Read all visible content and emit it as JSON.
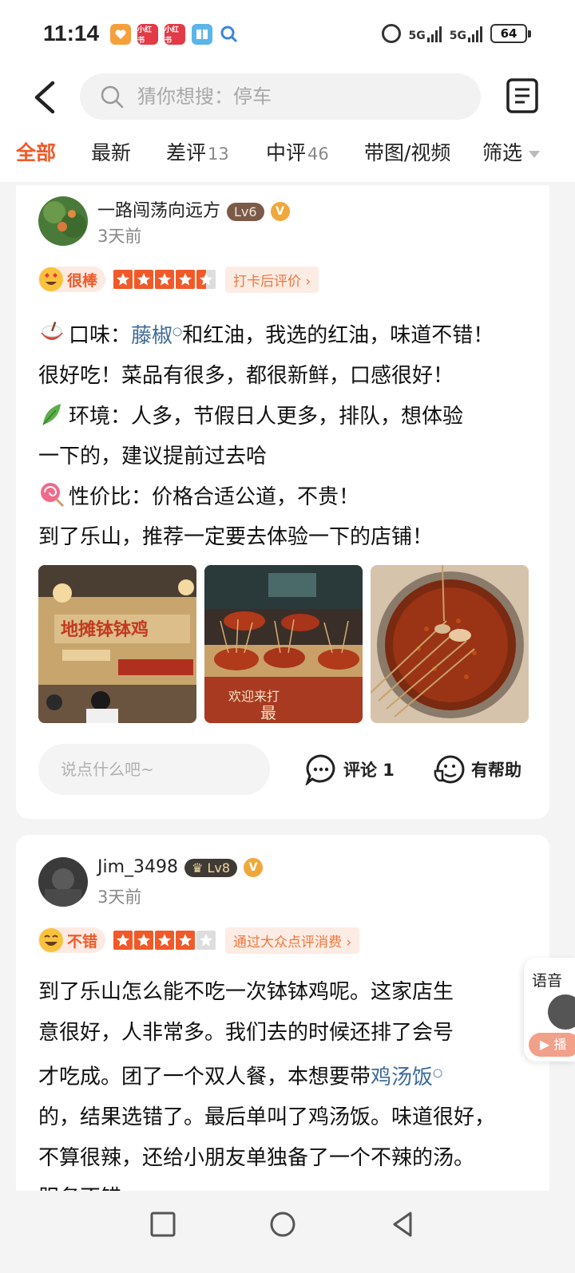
{
  "status_bar": {
    "time": "11:14",
    "app_icons": [
      {
        "name": "heart-app-icon",
        "color": "#f5a03b",
        "label": ""
      },
      {
        "name": "xiaohongshu-icon",
        "color": "#e23a46",
        "label": "小红书"
      },
      {
        "name": "xiaohongshu-icon",
        "color": "#e23a46",
        "label": "小红书"
      },
      {
        "name": "book-app-icon",
        "color": "#5bb5e8",
        "label": ""
      }
    ],
    "signal_1": "5G",
    "signal_2": "5G",
    "battery": "64"
  },
  "header": {
    "search_placeholder": "猜你想搜：停车"
  },
  "tabs": {
    "items": [
      {
        "label": "全部",
        "count": "",
        "active": true
      },
      {
        "label": "最新",
        "count": ""
      },
      {
        "label": "差评",
        "count": "13"
      },
      {
        "label": "中评",
        "count": "46"
      },
      {
        "label": "带图/视频",
        "count": ""
      }
    ],
    "filter": "筛选"
  },
  "reviews": [
    {
      "username": "一路闯荡向远方",
      "level": "Lv6",
      "time": "3天前",
      "rating_word": "很棒",
      "stars": 4.5,
      "source": "打卡后评价",
      "lines": {
        "l1_a": "口味：",
        "l1_kw": "藤椒",
        "l1_b": "和红油，我选的红油，味道不错！",
        "l2": "很好吃！菜品有很多，都很新鲜，口感很好！",
        "l3": "环境：人多，节假日人更多，排队，想体验",
        "l4": "一下的，建议提前过去哈",
        "l5": "性价比：价格合适公道，不贵！",
        "l6": "到了乐山，推荐一定要去体验一下的店铺！"
      },
      "photos": [
        {
          "desc_icon": "restaurant-wall-photo"
        },
        {
          "desc_icon": "skewer-pots-photo"
        },
        {
          "desc_icon": "chili-oil-pot-photo"
        }
      ],
      "comment_placeholder": "说点什么吧~",
      "comment_label": "评论 1",
      "helpful_label": "有帮助"
    },
    {
      "username": "Jim_3498",
      "level": "Lv8",
      "time": "3天前",
      "rating_word": "不错",
      "stars": 4,
      "source": "通过大众点评消费",
      "lines": {
        "l1": "到了乐山怎么能不吃一次钵钵鸡呢。这家店生",
        "l2": "意很好，人非常多。我们去的时候还排了会号",
        "l3_a": "才吃成。团了一个双人餐，本想要带",
        "l3_kw": "鸡汤饭",
        "l4": "的，结果选错了。最后单叫了鸡汤饭。味道很好，",
        "l5": "不算很辣，还给小朋友单独备了一个不辣的汤。",
        "l6": "服务不错"
      }
    }
  ],
  "float_widget": {
    "label": "语音",
    "play": "▶ 播"
  },
  "colors": {
    "accent": "#f05a28",
    "keyword": "#3e6b9a"
  }
}
